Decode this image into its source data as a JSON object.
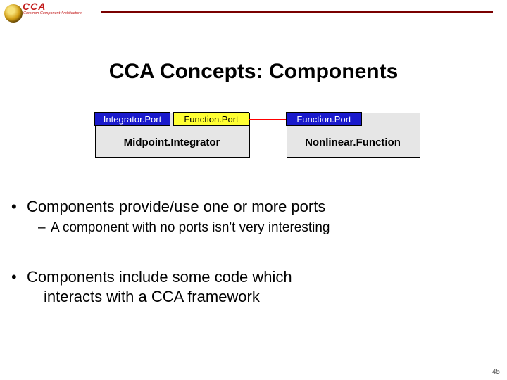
{
  "header": {
    "logo_text": "CCA",
    "logo_sub": "Common Component Architecture"
  },
  "title": "CCA Concepts: Components",
  "diagram": {
    "ports": {
      "integrator": "Integrator.Port",
      "function_left": "Function.Port",
      "function_right": "Function.Port"
    },
    "components": {
      "left": "Midpoint.Integrator",
      "right": "Nonlinear.Function"
    }
  },
  "bullets": {
    "b1": "Components provide/use one or more ports",
    "b1a": "A component with no ports isn't very interesting",
    "b2a": "Components include some code which",
    "b2b": "interacts with a CCA framework"
  },
  "glyphs": {
    "dot": "•",
    "dash": "–"
  },
  "page_number": "45"
}
